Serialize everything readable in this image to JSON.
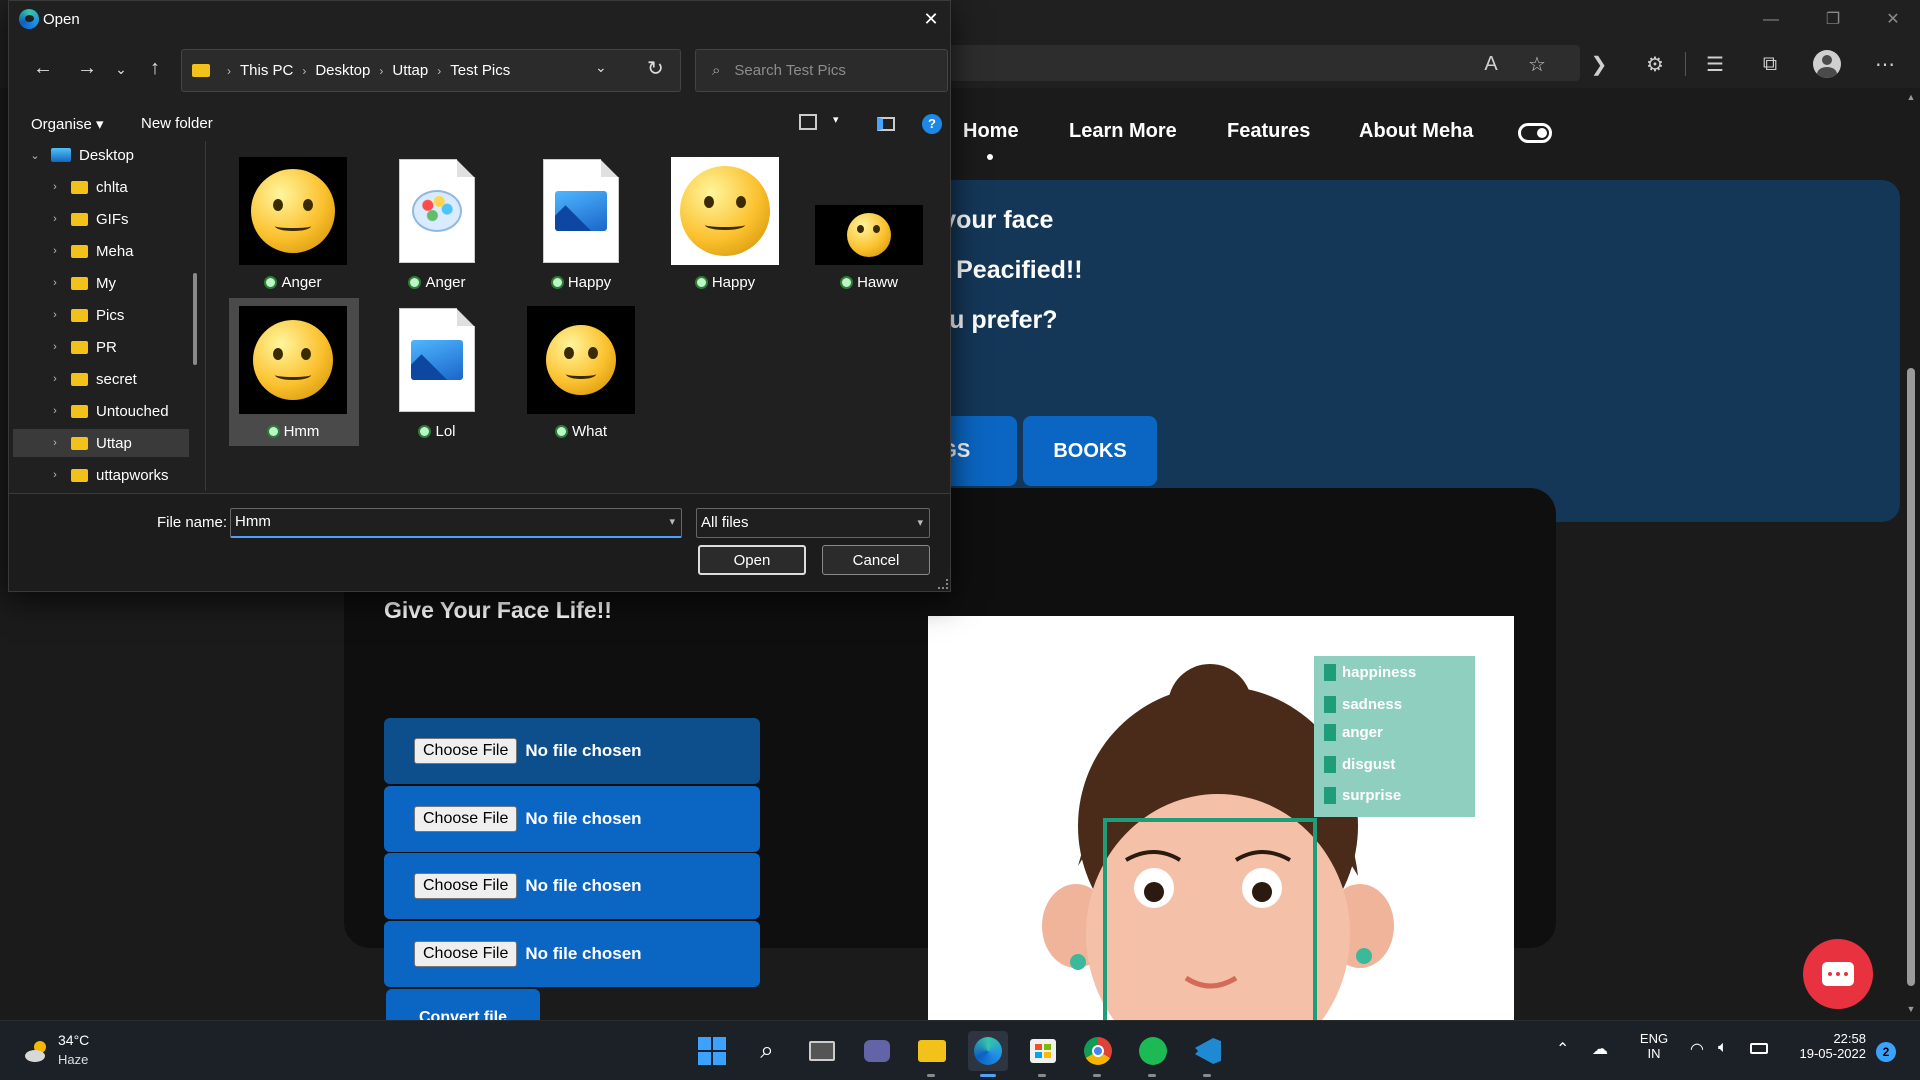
{
  "browser": {
    "toolbar_icons": [
      "read-aloud-icon",
      "favorite-add-icon",
      "chevron-icon",
      "extensions-icon",
      "favorites-icon",
      "collections-icon",
      "profile-icon",
      "more-icon"
    ]
  },
  "website": {
    "nav": {
      "items": [
        "Home",
        "Learn More",
        "Features",
        "About Meha"
      ],
      "active": "Home"
    },
    "hero": {
      "lines": [
        "n your face",
        "be Peacified!!",
        "you prefer?"
      ],
      "buttons": [
        "NGS",
        "BOOKS"
      ]
    },
    "upload": {
      "title": "Give Your Face Life!!",
      "rows": [
        {
          "button": "Choose File",
          "status": "No file chosen"
        },
        {
          "button": "Choose File",
          "status": "No file chosen"
        },
        {
          "button": "Choose File",
          "status": "No file chosen"
        },
        {
          "button": "Choose File",
          "status": "No file chosen"
        }
      ],
      "convert": "Convert file"
    },
    "emotions": [
      "happiness",
      "sadness",
      "anger",
      "disgust",
      "surprise"
    ]
  },
  "dialog": {
    "title": "Open",
    "breadcrumb": [
      "This PC",
      "Desktop",
      "Uttap",
      "Test Pics"
    ],
    "search_placeholder": "Search Test Pics",
    "commands": {
      "organise": "Organise",
      "new_folder": "New folder"
    },
    "tree": [
      {
        "label": "Desktop",
        "expanded": true
      },
      {
        "label": "chlta"
      },
      {
        "label": "GIFs"
      },
      {
        "label": "Meha"
      },
      {
        "label": "My"
      },
      {
        "label": "Pics"
      },
      {
        "label": "PR"
      },
      {
        "label": "secret"
      },
      {
        "label": "Untouched"
      },
      {
        "label": "Uttap",
        "selected": true
      },
      {
        "label": "uttapworks"
      }
    ],
    "files": [
      {
        "name": "Anger",
        "kind": "smiley"
      },
      {
        "name": "Anger",
        "kind": "paint"
      },
      {
        "name": "Happy",
        "kind": "image-doc"
      },
      {
        "name": "Happy",
        "kind": "smiley-white"
      },
      {
        "name": "Haww",
        "kind": "smiley"
      },
      {
        "name": "Hmm",
        "kind": "smiley",
        "selected": true
      },
      {
        "name": "Lol",
        "kind": "image-doc"
      },
      {
        "name": "What",
        "kind": "smiley"
      }
    ],
    "filename_label": "File name:",
    "filename_value": "Hmm",
    "filetype": "All files",
    "open_button": "Open",
    "cancel_button": "Cancel"
  },
  "taskbar": {
    "weather": {
      "temp": "34°C",
      "desc": "Haze"
    },
    "apps": [
      "start-icon",
      "search-icon",
      "task-view-icon",
      "teams-chat-icon",
      "file-explorer-icon",
      "edge-icon",
      "store-icon",
      "chrome-icon",
      "spotify-icon",
      "vscode-icon"
    ],
    "active_app": "edge-icon",
    "lang": [
      "ENG",
      "IN"
    ],
    "time": "22:58",
    "date": "19-05-2022",
    "notifications": "2"
  },
  "colors": {
    "hero_bg": "#143758",
    "button_blue": "#0a66c2",
    "chat_fab": "#e8323f",
    "emotion_panel": "#8fcfc0"
  }
}
